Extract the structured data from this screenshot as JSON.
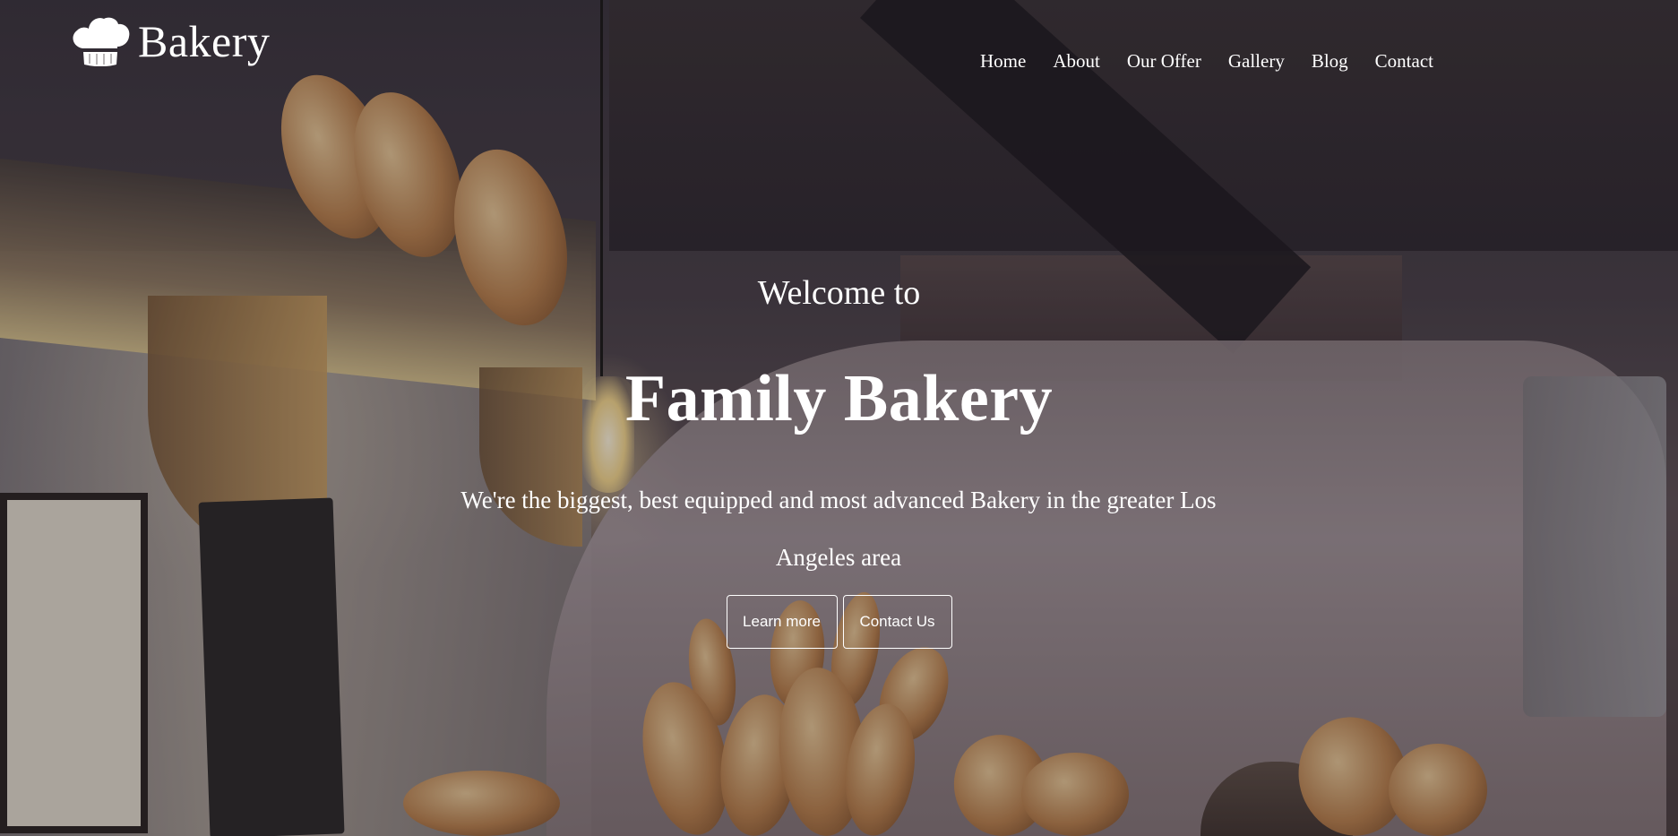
{
  "header": {
    "logo": {
      "icon": "chef-hat-icon",
      "text": "Bakery"
    },
    "nav": [
      {
        "label": "Home"
      },
      {
        "label": "About"
      },
      {
        "label": "Our Offer"
      },
      {
        "label": "Gallery"
      },
      {
        "label": "Blog"
      },
      {
        "label": "Contact"
      }
    ]
  },
  "hero": {
    "welcome": "Welcome to",
    "title": "Family Bakery",
    "subtitle": "We're the biggest, best equipped and most advanced Bakery in the greater Los Angeles area",
    "buttons": {
      "learn_more": "Learn more",
      "contact_us": "Contact Us"
    }
  },
  "colors": {
    "text": "#ffffff",
    "button_border": "#ffffff"
  }
}
